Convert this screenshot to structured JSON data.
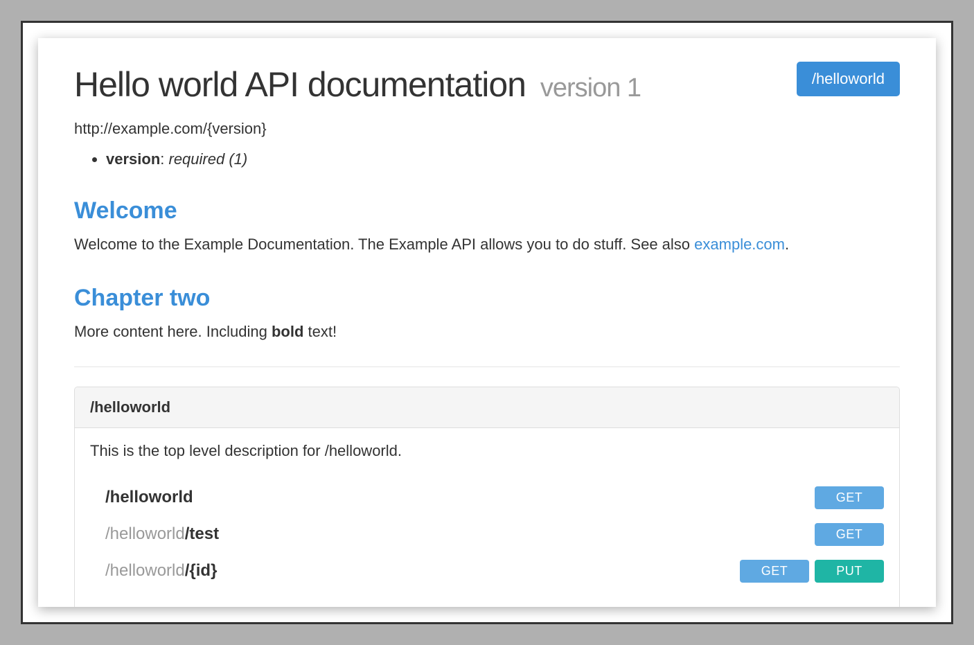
{
  "header": {
    "title": "Hello world API documentation",
    "version_label": "version 1",
    "base_url": "http://example.com/{version}",
    "params": [
      {
        "name": "version",
        "detail": "required (1)"
      }
    ],
    "nav_button": "/helloworld"
  },
  "sections": [
    {
      "heading": "Welcome",
      "text_pre": "Welcome to the Example Documentation. The Example API allows you to do stuff. See also ",
      "link_text": "example.com",
      "text_post": "."
    },
    {
      "heading": "Chapter two",
      "text_pre": "More content here. Including ",
      "bold_text": "bold",
      "text_post": " text!"
    }
  ],
  "panel": {
    "title": "/helloworld",
    "description": "This is the top level description for /helloworld.",
    "endpoints": [
      {
        "prefix": "",
        "path": "/helloworld",
        "methods": [
          "GET"
        ]
      },
      {
        "prefix": "/helloworld",
        "path": "/test",
        "methods": [
          "GET"
        ]
      },
      {
        "prefix": "/helloworld",
        "path": "/{id}",
        "methods": [
          "GET",
          "PUT"
        ]
      }
    ]
  },
  "method_labels": {
    "GET": "GET",
    "PUT": "PUT"
  }
}
